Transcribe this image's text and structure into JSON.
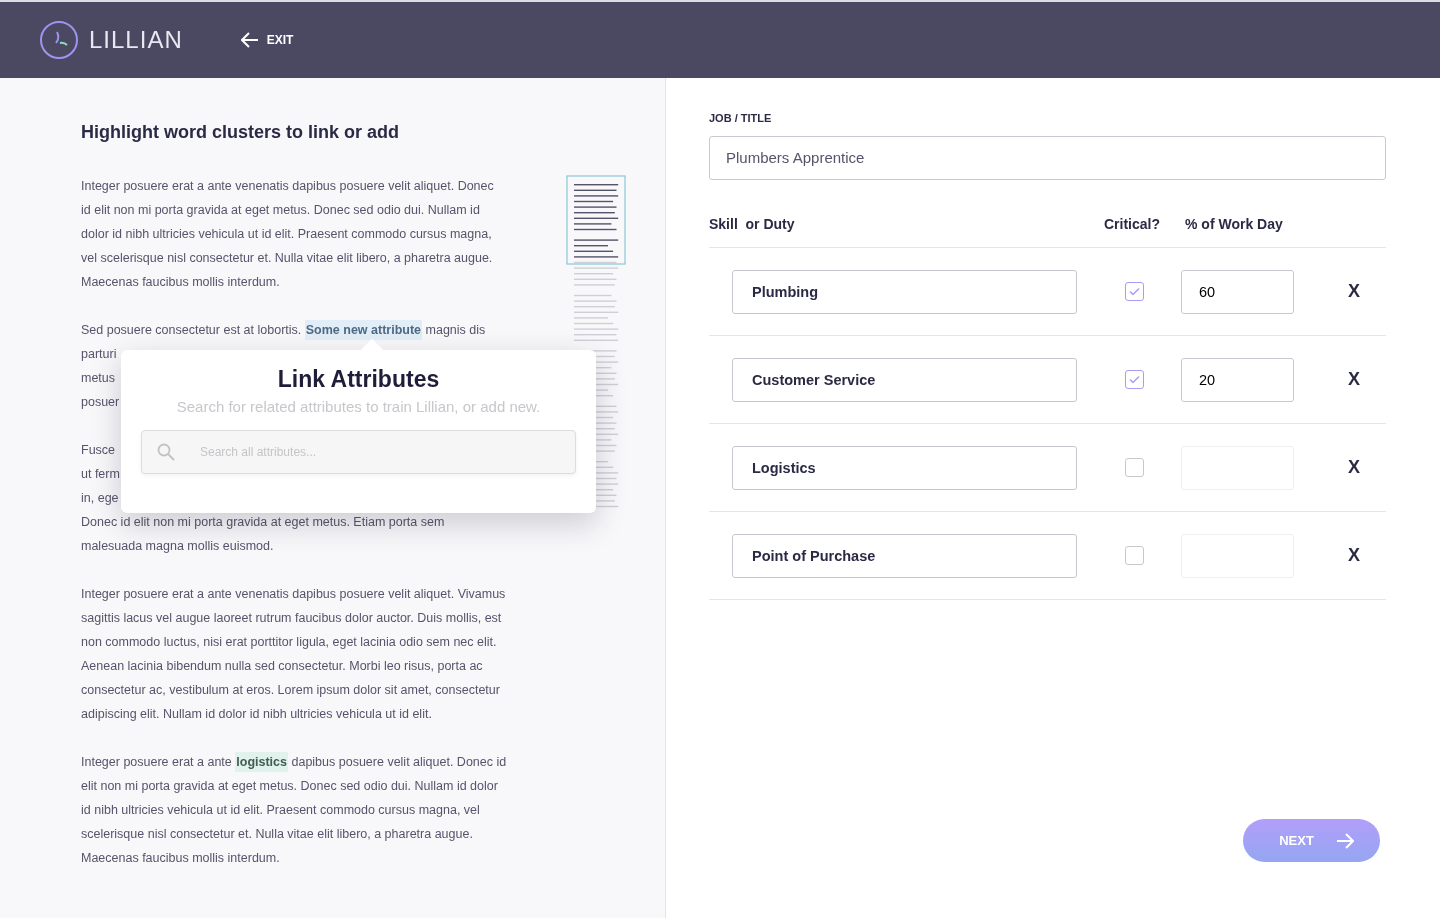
{
  "header": {
    "brand": "LILLIAN",
    "exit_label": "EXIT"
  },
  "document": {
    "heading": "Highlight word clusters to link or add",
    "paragraphs": [
      {
        "lines": [
          "Integer posuere erat a ante venenatis dapibus posuere velit aliquet. Donec",
          "id elit non mi porta gravida at eget metus. Donec sed odio dui. Nullam id",
          "dolor id nibh ultricies vehicula ut id elit. Praesent commodo cursus magna,",
          "vel scelerisque nisl consectetur et.  Nulla vitae elit libero, a pharetra augue.",
          "Maecenas faucibus mollis interdum."
        ]
      },
      {
        "kind": "attribute",
        "lines": [
          "Sed posuere consectetur est at lobortis. **Some new attribute** magnis dis",
          "parturi",
          "metus",
          "posuer"
        ]
      },
      {
        "lines": [
          "Fusce",
          "ut ferm",
          "in, ege",
          "Donec id elit non mi porta gravida at eget metus. Etiam porta sem",
          "malesuada magna mollis euismod."
        ]
      },
      {
        "lines": [
          "Integer posuere erat a ante venenatis dapibus posuere velit aliquet. Vivamus",
          "sagittis lacus vel augue laoreet rutrum faucibus dolor auctor. Duis mollis, est",
          "non commodo luctus, nisi erat porttitor ligula, eget lacinia odio sem nec elit.",
          "Aenean lacinia bibendum nulla sed consectetur. Morbi leo risus, porta ac",
          "consectetur ac, vestibulum at eros. Lorem ipsum dolor sit amet, consectetur",
          "adipiscing elit. Nullam id dolor id nibh ultricies vehicula ut id elit."
        ]
      },
      {
        "kind": "keyword",
        "lines": [
          "Integer posuere erat a ante **logistics** dapibus posuere velit aliquet. Donec id",
          "elit non mi porta gravida at eget metus. Donec sed odio dui. Nullam id dolor",
          "id nibh ultricies vehicula ut id elit. Praesent commodo cursus magna, vel",
          "scelerisque nisl consectetur et.  Nulla vitae elit libero, a pharetra augue.",
          "Maecenas faucibus mollis interdum."
        ]
      }
    ]
  },
  "popover": {
    "title": "Link Attributes",
    "subtitle": "Search for related attributes to train Lillian, or add new.",
    "search": {
      "placeholder": "Search all attributes..."
    }
  },
  "form": {
    "job_label": "JOB / TITLE",
    "job_value": "Plumbers Apprentice",
    "columns": [
      "Skill  or Duty",
      "Critical?",
      "% of Work Day"
    ],
    "rows": [
      {
        "skill": "Plumbing",
        "critical": true,
        "percent": "60",
        "remove": "X"
      },
      {
        "skill": "Customer Service",
        "critical": true,
        "percent": "20",
        "remove": "X"
      },
      {
        "skill": "Logistics",
        "critical": false,
        "remove": "X"
      },
      {
        "skill": "Point of Purchase",
        "critical": false,
        "remove": "X"
      }
    ],
    "next_label": "NEXT"
  }
}
